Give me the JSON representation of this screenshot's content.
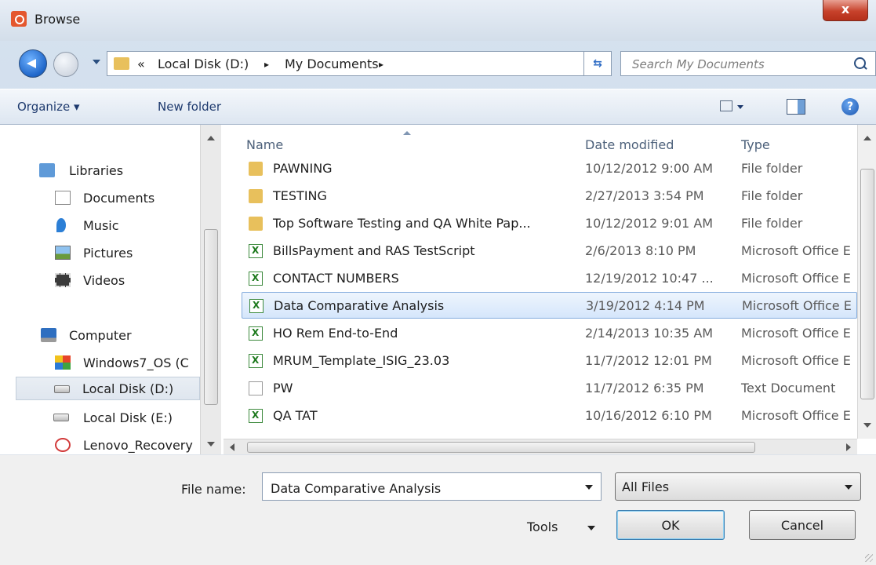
{
  "window": {
    "title": "Browse",
    "close_label": "x"
  },
  "address": {
    "prefix": "«",
    "crumbs": [
      "Local Disk (D:)",
      "My Documents"
    ],
    "separator": "▸"
  },
  "search": {
    "placeholder": "Search My Documents"
  },
  "toolbar": {
    "organize": "Organize ▾",
    "new_folder": "New folder",
    "help": "?"
  },
  "sidebar": {
    "items": [
      {
        "label": "Libraries",
        "icon": "libraries-icon"
      },
      {
        "label": "Documents",
        "icon": "documents-icon"
      },
      {
        "label": "Music",
        "icon": "music-icon"
      },
      {
        "label": "Pictures",
        "icon": "pictures-icon"
      },
      {
        "label": "Videos",
        "icon": "videos-icon"
      },
      {
        "label": "Computer",
        "icon": "computer-icon"
      },
      {
        "label": "Windows7_OS (C",
        "icon": "windows-drive-icon"
      },
      {
        "label": "Local Disk (D:)",
        "icon": "drive-icon",
        "selected": true
      },
      {
        "label": "Local Disk (E:)",
        "icon": "drive-icon"
      },
      {
        "label": "Lenovo_Recovery",
        "icon": "recovery-drive-icon"
      }
    ]
  },
  "columns": {
    "name": "Name",
    "date": "Date modified",
    "type": "Type"
  },
  "files": [
    {
      "name": "PAWNING",
      "date": "10/12/2012 9:00 AM",
      "type": "File folder",
      "icon": "folder"
    },
    {
      "name": "TESTING",
      "date": "2/27/2013 3:54 PM",
      "type": "File folder",
      "icon": "folder"
    },
    {
      "name": "Top Software Testing and QA White Pap...",
      "date": "10/12/2012 9:01 AM",
      "type": "File folder",
      "icon": "folder"
    },
    {
      "name": "BillsPayment and RAS TestScript",
      "date": "2/6/2013 8:10 PM",
      "type": "Microsoft Office E",
      "icon": "xls"
    },
    {
      "name": "CONTACT NUMBERS",
      "date": "12/19/2012 10:47 ...",
      "type": "Microsoft Office E",
      "icon": "xls"
    },
    {
      "name": "Data Comparative Analysis",
      "date": "3/19/2012 4:14 PM",
      "type": "Microsoft Office E",
      "icon": "xls",
      "selected": true
    },
    {
      "name": "HO Rem End-to-End",
      "date": "2/14/2013 10:35 AM",
      "type": "Microsoft Office E",
      "icon": "xls"
    },
    {
      "name": "MRUM_Template_ISIG_23.03",
      "date": "11/7/2012 12:01 PM",
      "type": "Microsoft Office E",
      "icon": "xls"
    },
    {
      "name": "PW",
      "date": "11/7/2012 6:35 PM",
      "type": "Text Document",
      "icon": "txt"
    },
    {
      "name": "QA TAT",
      "date": "10/16/2012 6:10 PM",
      "type": "Microsoft Office E",
      "icon": "xls"
    }
  ],
  "bottom": {
    "file_name_label": "File name:",
    "file_name_value": "Data Comparative Analysis",
    "file_type": "All Files",
    "tools": "Tools",
    "ok": "OK",
    "cancel": "Cancel"
  }
}
